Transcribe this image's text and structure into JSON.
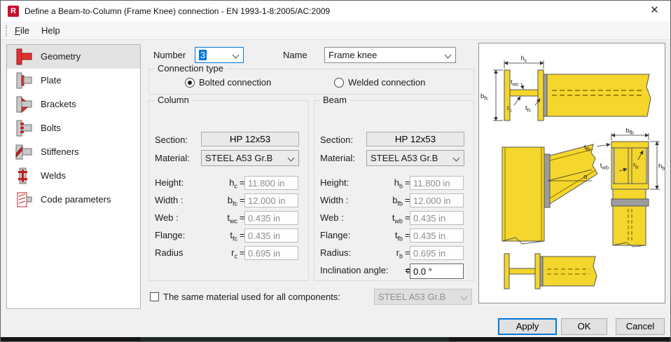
{
  "window": {
    "title": "Define a Beam-to-Column (Frame Knee) connection - EN 1993-1-8:2005/AC:2009",
    "close_glyph": "✕",
    "app_icon_letter": "R"
  },
  "menu": {
    "file_accel": "F",
    "file_rest": "ile",
    "help": "Help"
  },
  "sidebar": {
    "items": [
      {
        "label": "Geometry",
        "selected": true
      },
      {
        "label": "Plate",
        "selected": false
      },
      {
        "label": "Brackets",
        "selected": false
      },
      {
        "label": "Bolts",
        "selected": false
      },
      {
        "label": "Stiffeners",
        "selected": false
      },
      {
        "label": "Welds",
        "selected": false
      },
      {
        "label": "Code parameters",
        "selected": false
      }
    ]
  },
  "main": {
    "equals": "=",
    "number_label": "Number",
    "number_value": "3",
    "name_label": "Name",
    "name_value": "Frame knee",
    "connection_type": {
      "legend": "Connection type",
      "bolted": "Bolted connection",
      "welded": "Welded connection",
      "selected": "bolted"
    },
    "column": {
      "legend": "Column",
      "section_label": "Section:",
      "section_value": "HP 12x53",
      "material_label": "Material:",
      "material_value": "STEEL A53 Gr.B",
      "rows": [
        {
          "label": "Height:",
          "sym": "h",
          "sub": "c",
          "value": "11.800 in"
        },
        {
          "label": "Width :",
          "sym": "b",
          "sub": "fc",
          "value": "12.000 in"
        },
        {
          "label": "Web :",
          "sym": "t",
          "sub": "wc",
          "value": "0.435 in"
        },
        {
          "label": "Flange:",
          "sym": "t",
          "sub": "fc",
          "value": "0.435 in"
        },
        {
          "label": "Radius",
          "sym": "r",
          "sub": "c",
          "value": "0.695 in"
        }
      ]
    },
    "beam": {
      "legend": "Beam",
      "section_label": "Section:",
      "section_value": "HP 12x53",
      "material_label": "Material:",
      "material_value": "STEEL A53 Gr.B",
      "rows": [
        {
          "label": "Height:",
          "sym": "h",
          "sub": "b",
          "value": "11.800 in"
        },
        {
          "label": "Width :",
          "sym": "b",
          "sub": "fb",
          "value": "12.000 in"
        },
        {
          "label": "Web :",
          "sym": "t",
          "sub": "wb",
          "value": "0.435 in"
        },
        {
          "label": "Flange:",
          "sym": "t",
          "sub": "fb",
          "value": "0.435 in"
        },
        {
          "label": "Radius:",
          "sym": "r",
          "sub": "b",
          "value": "0.695 in"
        }
      ],
      "inclination": {
        "label": "Inclination angle:",
        "sym": "α",
        "value": "0.0 °"
      }
    },
    "same_material": {
      "label": "The same material used for all components:",
      "checked": false,
      "value": "STEEL A53 Gr.B"
    }
  },
  "diagram": {
    "hc": {
      "base": "h",
      "sub": "c"
    },
    "bfc": {
      "base": "b",
      "sub": "fc"
    },
    "twc": {
      "base": "t",
      "sub": "wc"
    },
    "rc": {
      "base": "r",
      "sub": "c"
    },
    "tfc": {
      "base": "t",
      "sub": "fc"
    },
    "bfb": {
      "base": "b",
      "sub": "fb"
    },
    "tfb": {
      "base": "t",
      "sub": "fb"
    },
    "twb": {
      "base": "t",
      "sub": "wb"
    },
    "rb": {
      "base": "r",
      "sub": "b"
    },
    "hb": {
      "base": "h",
      "sub": "b"
    },
    "alpha": "α"
  },
  "footer": {
    "apply": "Apply",
    "ok": "OK",
    "cancel": "Cancel"
  },
  "colors": {
    "accent": "#0078d7",
    "brand_red": "#c8102e",
    "diagram_yellow": "#f4d62c",
    "plate_gray": "#9c9c9c"
  }
}
